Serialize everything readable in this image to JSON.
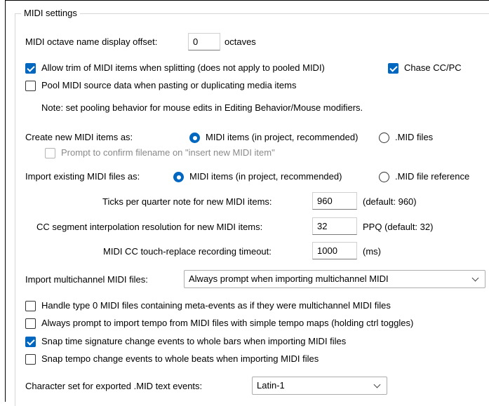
{
  "group": {
    "title": "MIDI settings"
  },
  "octave": {
    "label": "MIDI octave name display offset:",
    "value": "0",
    "unit": "octaves"
  },
  "allow_trim": {
    "label": "Allow trim of MIDI items when splitting (does not apply to pooled MIDI)",
    "checked": true
  },
  "chase_cc": {
    "label": "Chase CC/PC",
    "checked": true
  },
  "pool_midi": {
    "label": "Pool MIDI source data when pasting or duplicating media items",
    "checked": false
  },
  "note": "Note: set pooling behavior for mouse edits in Editing Behavior/Mouse modifiers.",
  "create_new": {
    "label": "Create new MIDI items as:",
    "options": [
      "MIDI items (in project, recommended)",
      ".MID files"
    ],
    "selected": 0
  },
  "prompt_confirm": {
    "label": "Prompt to confirm filename on \"insert new MIDI item\"",
    "checked": false,
    "disabled": true
  },
  "import_existing": {
    "label": "Import existing MIDI files as:",
    "options": [
      "MIDI items (in project, recommended)",
      ".MID file reference"
    ],
    "selected": 0
  },
  "ticks": {
    "label": "Ticks per quarter note for new MIDI items:",
    "value": "960",
    "hint": "(default: 960)"
  },
  "cc_segment": {
    "label": "CC segment interpolation resolution for new MIDI items:",
    "value": "32",
    "hint": "PPQ (default: 32)"
  },
  "cc_touch": {
    "label": "MIDI CC touch-replace recording timeout:",
    "value": "1000",
    "hint": "(ms)"
  },
  "import_multichannel": {
    "label": "Import multichannel MIDI files:",
    "value": "Always prompt when importing multichannel MIDI"
  },
  "options": [
    {
      "label": "Handle type 0 MIDI files containing meta-events as if they were multichannel MIDI files",
      "checked": false
    },
    {
      "label": "Always prompt to import tempo from MIDI files with simple tempo maps (holding ctrl toggles)",
      "checked": false
    },
    {
      "label": "Snap time signature change events to whole bars when importing MIDI files",
      "checked": true
    },
    {
      "label": "Snap tempo change events to whole beats when importing MIDI files",
      "checked": false
    }
  ],
  "charset": {
    "label": "Character set for exported .MID text events:",
    "value": "Latin-1"
  },
  "colors": {
    "accent": "#0067c0",
    "group_border": "#d6d6d6",
    "disabled_text": "#8a8a8a"
  },
  "icons": {
    "dropdown": "chevron-down-icon",
    "check": "check-icon"
  }
}
